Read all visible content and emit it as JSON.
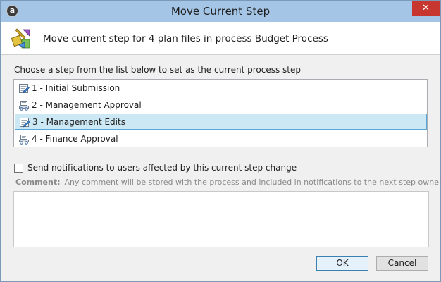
{
  "window": {
    "title": "Move Current Step",
    "app_icon_letter": "a",
    "close_glyph": "✕"
  },
  "header": {
    "text": "Move current step for 4 plan files in process Budget Process",
    "icon": "move-step-icon"
  },
  "instruction": "Choose a step from the list below to set as the current process step",
  "steps": [
    {
      "label": "1 - Initial Submission",
      "icon": "edit-document-icon",
      "selected": false
    },
    {
      "label": "2 - Management Approval",
      "icon": "approval-icon",
      "selected": false
    },
    {
      "label": "3 - Management Edits",
      "icon": "edit-document-icon",
      "selected": true
    },
    {
      "label": "4 - Finance Approval",
      "icon": "approval-icon",
      "selected": false
    }
  ],
  "notify": {
    "label": "Send notifications to users affected by this current step change",
    "checked": false
  },
  "comment": {
    "label": "Comment:",
    "hint": "Any comment will be stored with the process and included in notifications to the next step owner.",
    "value": ""
  },
  "buttons": {
    "ok": "OK",
    "cancel": "Cancel"
  },
  "colors": {
    "titlebar": "#a4c5e5",
    "selection": "#cce8f4",
    "selection_border": "#57a8d9",
    "close": "#c7372f"
  }
}
